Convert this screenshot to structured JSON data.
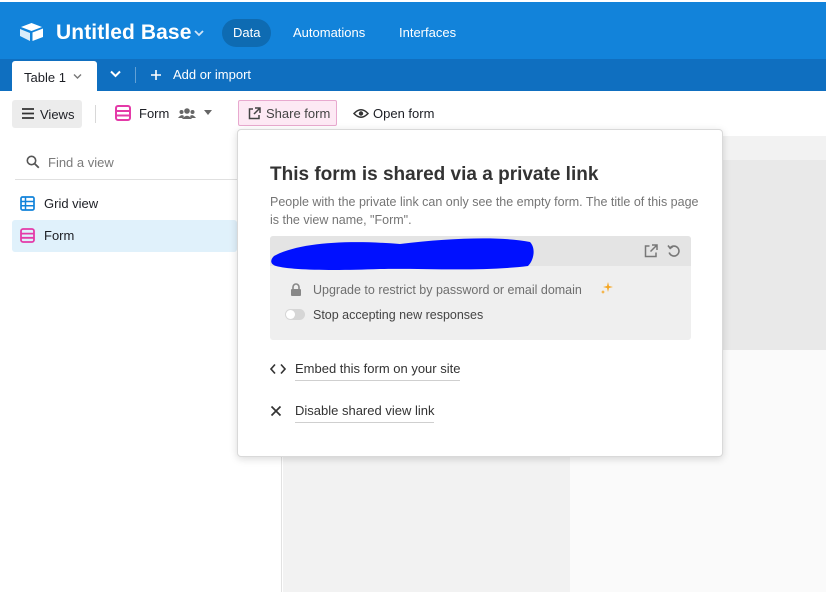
{
  "header": {
    "base_title": "Untitled Base",
    "nav": [
      "Data",
      "Automations",
      "Interfaces"
    ],
    "active_nav": "Data",
    "brand_color": "#1283da"
  },
  "tabs": {
    "table_tab": "Table 1",
    "add_import": "Add or import"
  },
  "viewbar": {
    "views_label": "Views",
    "current_view": "Form",
    "share_form": "Share form",
    "open_form": "Open form"
  },
  "sidebar": {
    "search_placeholder": "Find a view",
    "items": [
      {
        "label": "Grid view",
        "icon": "grid-view-icon",
        "selected": false
      },
      {
        "label": "Form",
        "icon": "form-view-icon",
        "selected": true
      }
    ]
  },
  "share_popover": {
    "title": "This form is shared via a private link",
    "description": "People with the private link can only see the empty form. The title of this page is the view name, \"Form\".",
    "link_redacted": true,
    "upgrade_text": "Upgrade to restrict by password or email domain",
    "stop_accepting": "Stop accepting new responses",
    "stop_accepting_on": false,
    "embed_label": "Embed this form on your site",
    "disable_label": "Disable shared view link"
  },
  "colors": {
    "form_pink": "#e43aa8",
    "grid_blue": "#1283da",
    "redaction": "#0010ff"
  }
}
